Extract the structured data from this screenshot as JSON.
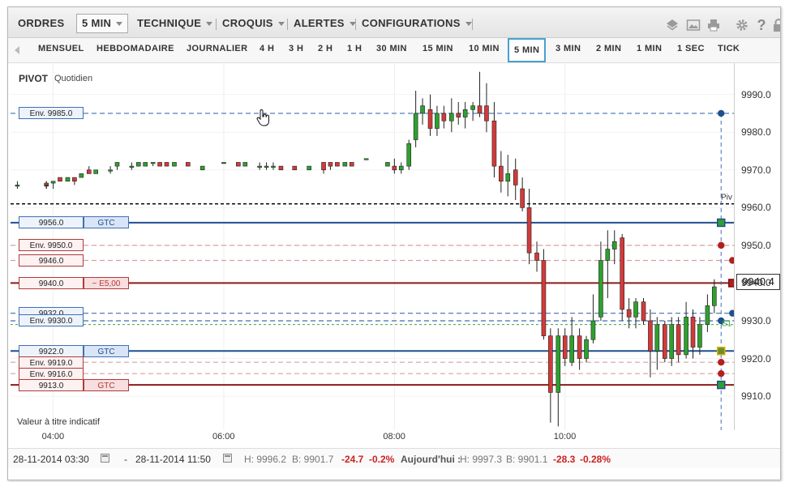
{
  "menu": {
    "items": [
      {
        "label": "ORDRES",
        "caret": false
      },
      {
        "label": "5 MIN",
        "caret": true
      },
      {
        "label": "TECHNIQUE",
        "caret": true
      },
      {
        "label": "CROQUIS",
        "caret": true
      },
      {
        "label": "ALERTES",
        "caret": true
      },
      {
        "label": "CONFIGURATIONS",
        "caret": true
      }
    ],
    "tools": [
      "layers-icon",
      "image-icon",
      "print-icon",
      "gear-icon",
      "help-icon",
      "lock-icon"
    ]
  },
  "timeframes": {
    "items": [
      "MENSUEL",
      "HEBDOMADAIRE",
      "JOURNALIER",
      "4 H",
      "3 H",
      "2 H",
      "1 H",
      "30 MIN",
      "15 MIN",
      "10 MIN",
      "5 MIN",
      "3 MIN",
      "2 MIN",
      "1 MIN",
      "1 SEC",
      "TICK"
    ],
    "selected": "5 MIN"
  },
  "chart": {
    "title": "PIVOT",
    "subtitle": "Quotidien",
    "note": "Valeur à titre indicatif",
    "pivot_tag": "Piv",
    "s1_tag": "S1",
    "current_price": "9940.4",
    "colors": {
      "up": "#2ea02e",
      "down": "#d23a3a",
      "blue": "#1f4f8f",
      "red": "#8b1a1a"
    }
  },
  "orders": [
    {
      "price_label": "Env. 9985.0",
      "tag": "",
      "price": 9985,
      "color": "blue",
      "style": "dashed"
    },
    {
      "price_label": "9956.0",
      "tag": "GTC",
      "price": 9956,
      "color": "blue",
      "style": "solid"
    },
    {
      "price_label": "Env. 9950.0",
      "tag": "",
      "price": 9950,
      "color": "red",
      "style": "dashed"
    },
    {
      "price_label": "9946.0",
      "tag": "",
      "price": 9946,
      "color": "red",
      "style": "dashed"
    },
    {
      "price_label": "9940.0",
      "tag": "− E5,00",
      "price": 9940,
      "color": "red",
      "style": "solid"
    },
    {
      "price_label": "9932.0",
      "tag": "",
      "price": 9932,
      "color": "blue",
      "style": "dashed"
    },
    {
      "price_label": "Env. 9930.0",
      "tag": "",
      "price": 9930,
      "color": "blue",
      "style": "dashed"
    },
    {
      "price_label": "9922.0",
      "tag": "GTC",
      "price": 9922,
      "color": "blue",
      "style": "solid"
    },
    {
      "price_label": "Env. 9919.0",
      "tag": "",
      "price": 9919,
      "color": "red",
      "style": "dashed"
    },
    {
      "price_label": "Env. 9916.0",
      "tag": "",
      "price": 9916,
      "color": "red",
      "style": "dashed"
    },
    {
      "price_label": "9913.0",
      "tag": "GTC",
      "price": 9913,
      "color": "red",
      "style": "solid"
    }
  ],
  "chart_data": {
    "type": "candlestick",
    "ylim": [
      9901,
      10000
    ],
    "y_ticks": [
      "9990.0",
      "9980.0",
      "9970.0",
      "9960.0",
      "9950.0",
      "9940.0",
      "9930.0",
      "9920.0",
      "9910.0"
    ],
    "y_tick_values": [
      9990,
      9980,
      9970,
      9960,
      9950,
      9940,
      9930,
      9920,
      9910
    ],
    "x_ticks": [
      "04:00",
      "06:00",
      "08:00",
      "10:00"
    ],
    "x_tick_hours": [
      4,
      6,
      8,
      10
    ],
    "x_start_hour": 3.5,
    "x_end_hour": 11.833,
    "pivot": 9961,
    "s1": 9929,
    "candles": [
      {
        "t": 3.58,
        "o": 9966,
        "h": 9967,
        "l": 9965,
        "c": 9966
      },
      {
        "t": 3.92,
        "o": 9966,
        "h": 9967,
        "l": 9965,
        "c": 9966
      },
      {
        "t": 3.92,
        "o": 9966.5,
        "h": 9967,
        "l": 9965,
        "c": 9966
      },
      {
        "t": 4.0,
        "o": 9966.5,
        "h": 9967,
        "l": 9965,
        "c": 9967
      },
      {
        "t": 4.08,
        "o": 9968,
        "h": 9968,
        "l": 9967,
        "c": 9967
      },
      {
        "t": 4.17,
        "o": 9967,
        "h": 9968,
        "l": 9967,
        "c": 9968
      },
      {
        "t": 4.25,
        "o": 9968,
        "h": 9968,
        "l": 9966,
        "c": 9967
      },
      {
        "t": 4.33,
        "o": 9968,
        "h": 9969,
        "l": 9968,
        "c": 9969
      },
      {
        "t": 4.42,
        "o": 9970,
        "h": 9971,
        "l": 9969,
        "c": 9969
      },
      {
        "t": 4.5,
        "o": 9969,
        "h": 9970,
        "l": 9969,
        "c": 9970
      },
      {
        "t": 4.67,
        "o": 9970,
        "h": 9971,
        "l": 9969,
        "c": 9970
      },
      {
        "t": 4.75,
        "o": 9971,
        "h": 9972,
        "l": 9970,
        "c": 9972
      },
      {
        "t": 4.92,
        "o": 9971,
        "h": 9972,
        "l": 9970,
        "c": 9971
      },
      {
        "t": 5.0,
        "o": 9971,
        "h": 9972,
        "l": 9971,
        "c": 9972
      },
      {
        "t": 5.08,
        "o": 9971,
        "h": 9972,
        "l": 9971,
        "c": 9972
      },
      {
        "t": 5.17,
        "o": 9972,
        "h": 9972,
        "l": 9971,
        "c": 9972
      },
      {
        "t": 5.25,
        "o": 9972,
        "h": 9972,
        "l": 9971,
        "c": 9971
      },
      {
        "t": 5.33,
        "o": 9972,
        "h": 9972,
        "l": 9971,
        "c": 9971
      },
      {
        "t": 5.42,
        "o": 9971,
        "h": 9972,
        "l": 9971,
        "c": 9972
      },
      {
        "t": 5.58,
        "o": 9972,
        "h": 9972,
        "l": 9971,
        "c": 9971
      },
      {
        "t": 5.75,
        "o": 9970,
        "h": 9971,
        "l": 9970,
        "c": 9971
      },
      {
        "t": 6.0,
        "o": 9972,
        "h": 9972,
        "l": 9972,
        "c": 9972
      },
      {
        "t": 6.17,
        "o": 9972,
        "h": 9972,
        "l": 9971,
        "c": 9971
      },
      {
        "t": 6.25,
        "o": 9971,
        "h": 9972,
        "l": 9971,
        "c": 9972
      },
      {
        "t": 6.42,
        "o": 9971,
        "h": 9972,
        "l": 9970,
        "c": 9971
      },
      {
        "t": 6.5,
        "o": 9971,
        "h": 9972,
        "l": 9970,
        "c": 9971
      },
      {
        "t": 6.58,
        "o": 9971,
        "h": 9972,
        "l": 9970,
        "c": 9971
      },
      {
        "t": 6.67,
        "o": 9971,
        "h": 9971,
        "l": 9970,
        "c": 9970
      },
      {
        "t": 6.83,
        "o": 9971,
        "h": 9971,
        "l": 9970,
        "c": 9970
      },
      {
        "t": 7.0,
        "o": 9970,
        "h": 9971,
        "l": 9970,
        "c": 9971
      },
      {
        "t": 7.17,
        "o": 9972,
        "h": 9972,
        "l": 9969,
        "c": 9970
      },
      {
        "t": 7.25,
        "o": 9972,
        "h": 9972,
        "l": 9970,
        "c": 9971
      },
      {
        "t": 7.33,
        "o": 9972,
        "h": 9972,
        "l": 9971,
        "c": 9971
      },
      {
        "t": 7.42,
        "o": 9971,
        "h": 9972,
        "l": 9971,
        "c": 9972
      },
      {
        "t": 7.5,
        "o": 9972,
        "h": 9972,
        "l": 9971,
        "c": 9971
      },
      {
        "t": 7.67,
        "o": 9973,
        "h": 9973,
        "l": 9973,
        "c": 9973
      },
      {
        "t": 7.92,
        "o": 9971,
        "h": 9972,
        "l": 9971,
        "c": 9972
      },
      {
        "t": 8.0,
        "o": 9971,
        "h": 9973,
        "l": 9969,
        "c": 9970
      },
      {
        "t": 8.08,
        "o": 9970,
        "h": 9972,
        "l": 9969,
        "c": 9971
      },
      {
        "t": 8.17,
        "o": 9971,
        "h": 9978,
        "l": 9970,
        "c": 9977
      },
      {
        "t": 8.25,
        "o": 9978,
        "h": 9991,
        "l": 9976,
        "c": 9985
      },
      {
        "t": 8.33,
        "o": 9985,
        "h": 9989,
        "l": 9982,
        "c": 9987
      },
      {
        "t": 8.42,
        "o": 9986,
        "h": 9990,
        "l": 9979,
        "c": 9981
      },
      {
        "t": 8.5,
        "o": 9981,
        "h": 9987,
        "l": 9979,
        "c": 9985
      },
      {
        "t": 8.58,
        "o": 9985,
        "h": 9987,
        "l": 9981,
        "c": 9983
      },
      {
        "t": 8.67,
        "o": 9983,
        "h": 9989,
        "l": 9980,
        "c": 9985
      },
      {
        "t": 8.75,
        "o": 9985,
        "h": 9988,
        "l": 9982,
        "c": 9984
      },
      {
        "t": 8.83,
        "o": 9984,
        "h": 9988,
        "l": 9981,
        "c": 9986
      },
      {
        "t": 8.92,
        "o": 9986,
        "h": 9988,
        "l": 9983,
        "c": 9987
      },
      {
        "t": 9.0,
        "o": 9987,
        "h": 9996,
        "l": 9984,
        "c": 9985
      },
      {
        "t": 9.08,
        "o": 9987,
        "h": 9993,
        "l": 9980,
        "c": 9983
      },
      {
        "t": 9.17,
        "o": 9983,
        "h": 9988,
        "l": 9968,
        "c": 9971
      },
      {
        "t": 9.25,
        "o": 9971,
        "h": 9975,
        "l": 9964,
        "c": 9967
      },
      {
        "t": 9.33,
        "o": 9967,
        "h": 9974,
        "l": 9963,
        "c": 9969
      },
      {
        "t": 9.42,
        "o": 9970,
        "h": 9973,
        "l": 9962,
        "c": 9966
      },
      {
        "t": 9.5,
        "o": 9965,
        "h": 9968,
        "l": 9959,
        "c": 9960
      },
      {
        "t": 9.58,
        "o": 9960,
        "h": 9965,
        "l": 9945,
        "c": 9948
      },
      {
        "t": 9.67,
        "o": 9948,
        "h": 9951,
        "l": 9943,
        "c": 9946
      },
      {
        "t": 9.75,
        "o": 9946,
        "h": 9949,
        "l": 9925,
        "c": 9926
      },
      {
        "t": 9.83,
        "o": 9926,
        "h": 9928,
        "l": 9903,
        "c": 9911
      },
      {
        "t": 9.92,
        "o": 9911,
        "h": 9928,
        "l": 9902,
        "c": 9926
      },
      {
        "t": 10.0,
        "o": 9926,
        "h": 9928,
        "l": 9918,
        "c": 9920
      },
      {
        "t": 10.08,
        "o": 9919,
        "h": 9931,
        "l": 9918,
        "c": 9926
      },
      {
        "t": 10.17,
        "o": 9926,
        "h": 9928,
        "l": 9917,
        "c": 9920
      },
      {
        "t": 10.25,
        "o": 9920,
        "h": 9926,
        "l": 9919,
        "c": 9925
      },
      {
        "t": 10.33,
        "o": 9925,
        "h": 9937,
        "l": 9924,
        "c": 9930
      },
      {
        "t": 10.42,
        "o": 9931,
        "h": 9951,
        "l": 9930,
        "c": 9946
      },
      {
        "t": 10.5,
        "o": 9946,
        "h": 9954,
        "l": 9936,
        "c": 9949
      },
      {
        "t": 10.58,
        "o": 9949,
        "h": 9954,
        "l": 9945,
        "c": 9951
      },
      {
        "t": 10.67,
        "o": 9952,
        "h": 9953,
        "l": 9930,
        "c": 9933
      },
      {
        "t": 10.75,
        "o": 9933,
        "h": 9936,
        "l": 9928,
        "c": 9931
      },
      {
        "t": 10.83,
        "o": 9931,
        "h": 9936,
        "l": 9928,
        "c": 9935
      },
      {
        "t": 10.92,
        "o": 9935,
        "h": 9936,
        "l": 9929,
        "c": 9930
      },
      {
        "t": 11.0,
        "o": 9930,
        "h": 9933,
        "l": 9915,
        "c": 9922
      },
      {
        "t": 11.08,
        "o": 9922,
        "h": 9931,
        "l": 9917,
        "c": 9929
      },
      {
        "t": 11.17,
        "o": 9929,
        "h": 9930,
        "l": 9919,
        "c": 9920
      },
      {
        "t": 11.25,
        "o": 9920,
        "h": 9931,
        "l": 9918,
        "c": 9929
      },
      {
        "t": 11.33,
        "o": 9929,
        "h": 9931,
        "l": 9919,
        "c": 9921
      },
      {
        "t": 11.42,
        "o": 9921,
        "h": 9935,
        "l": 9920,
        "c": 9931
      },
      {
        "t": 11.5,
        "o": 9931,
        "h": 9933,
        "l": 9920,
        "c": 9923
      },
      {
        "t": 11.58,
        "o": 9923,
        "h": 9931,
        "l": 9921,
        "c": 9929
      },
      {
        "t": 11.67,
        "o": 9929,
        "h": 9937,
        "l": 9927,
        "c": 9934
      },
      {
        "t": 11.75,
        "o": 9934,
        "h": 9941,
        "l": 9932,
        "c": 9939
      }
    ]
  },
  "cursor": {
    "name": "hand-cursor-icon"
  },
  "status": {
    "start": "28-11-2014 03:30",
    "dash": "-",
    "end": "28-11-2014 11:50",
    "h_label": "H: 9996.2",
    "b_label": "B: 9901.7",
    "chg": "-24.7",
    "chg_pct": "-0.2%",
    "today_label": "Aujourd'hui :",
    "today_h": "H: 9997.3",
    "today_b": "B: 9901.1",
    "today_chg": "-28.3",
    "today_chg_pct": "-0.28%"
  }
}
